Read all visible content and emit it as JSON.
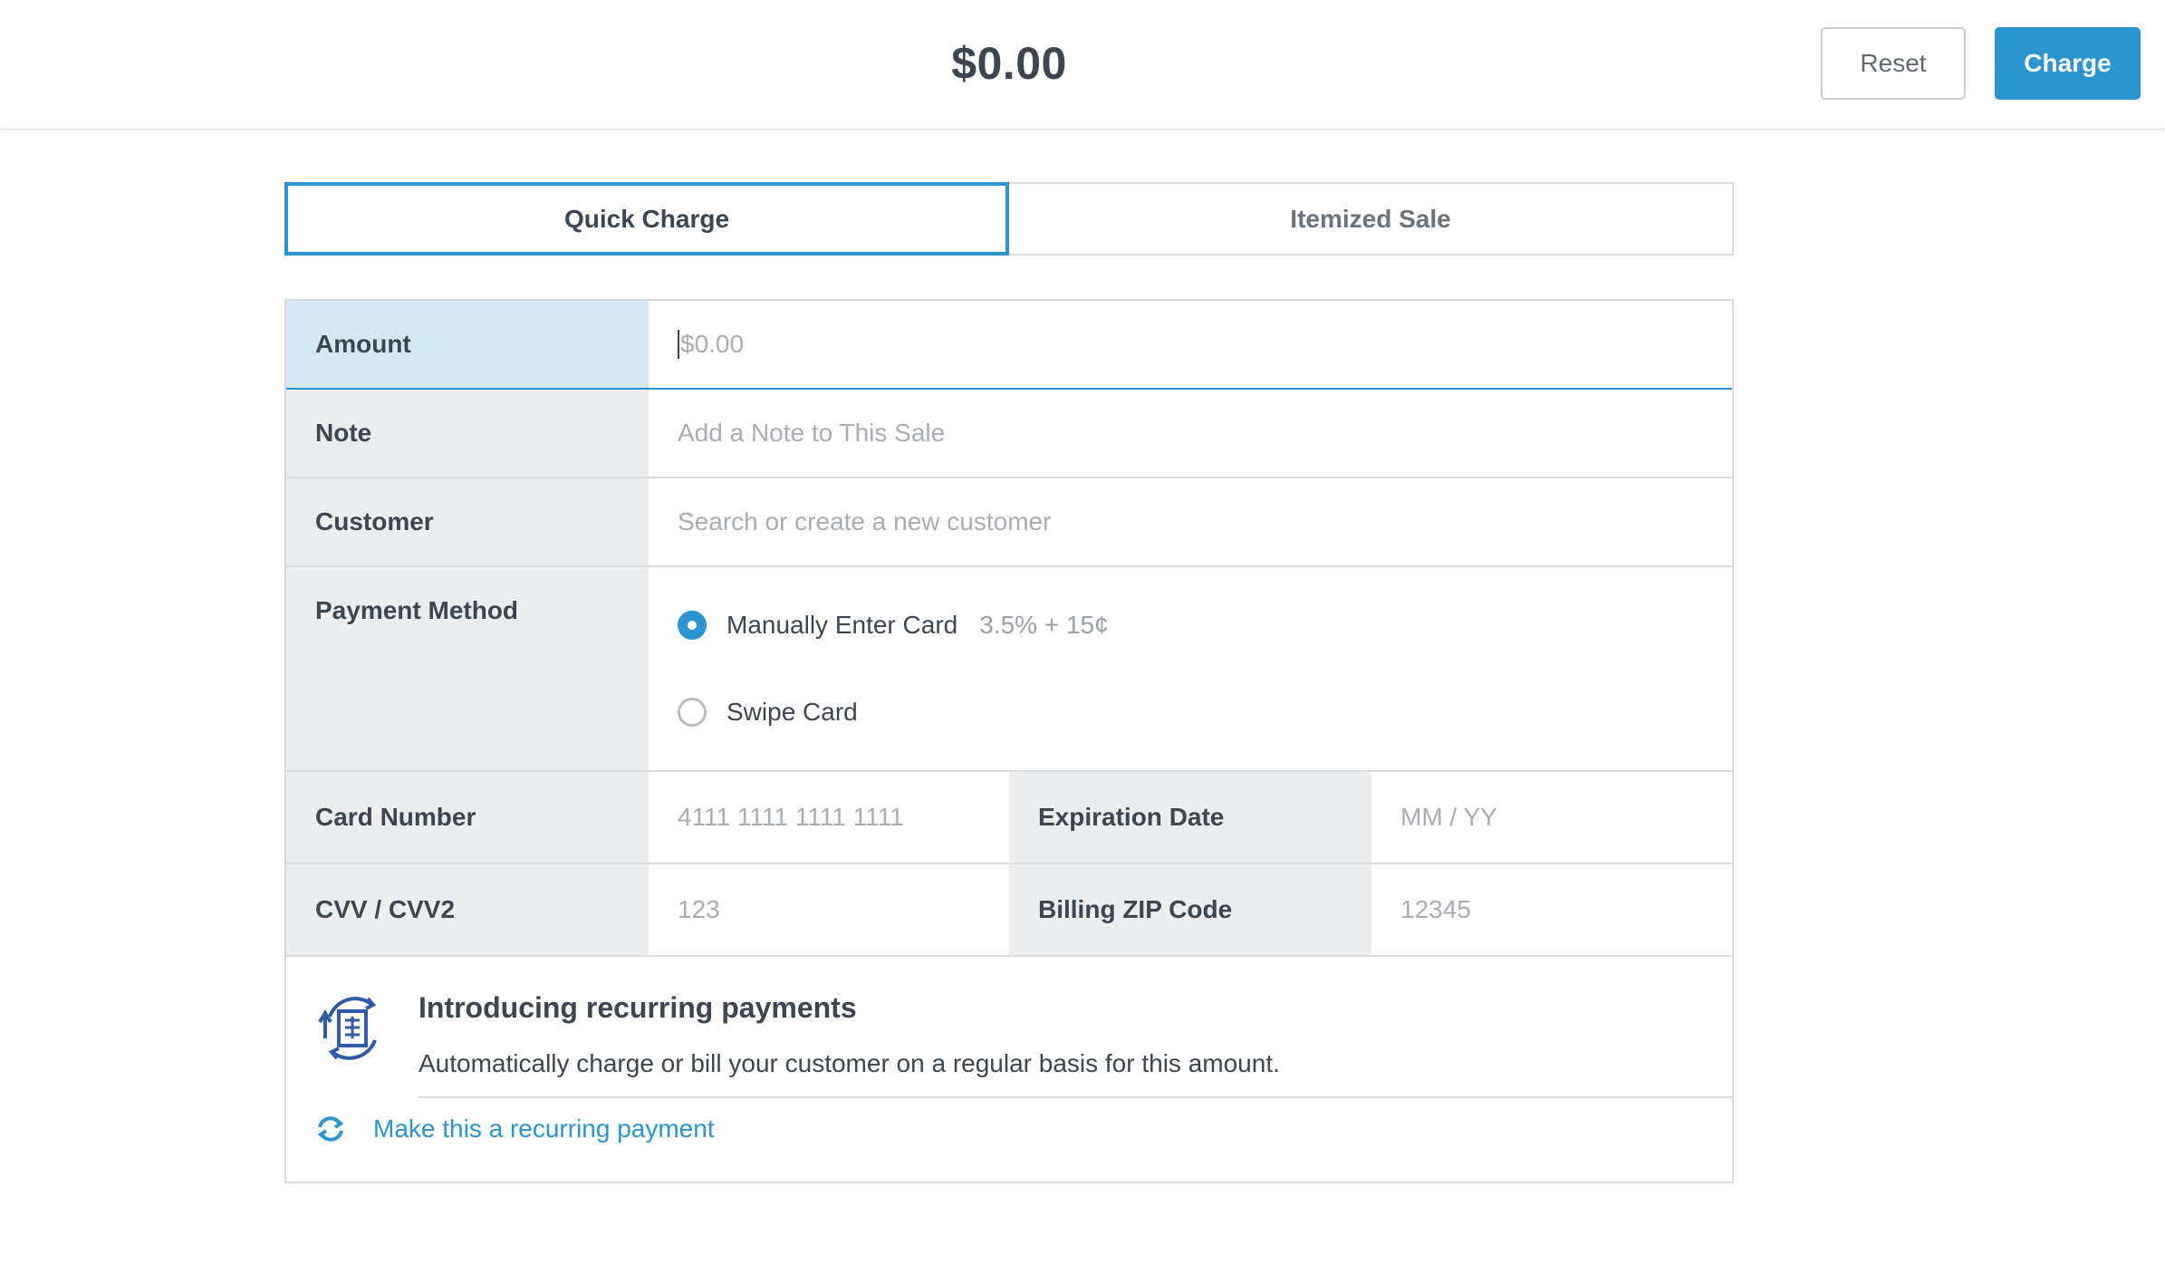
{
  "header": {
    "total": "$0.00",
    "reset_label": "Reset",
    "charge_label": "Charge"
  },
  "tabs": [
    {
      "label": "Quick Charge",
      "active": true
    },
    {
      "label": "Itemized Sale",
      "active": false
    }
  ],
  "form": {
    "amount": {
      "label": "Amount",
      "placeholder": "$0.00",
      "value": ""
    },
    "note": {
      "label": "Note",
      "placeholder": "Add a Note to This Sale"
    },
    "customer": {
      "label": "Customer",
      "placeholder": "Search or create a new customer"
    },
    "payment_method": {
      "label": "Payment Method",
      "options": [
        {
          "label": "Manually Enter Card",
          "fee": "3.5% + 15¢",
          "selected": true
        },
        {
          "label": "Swipe Card",
          "selected": false
        }
      ]
    },
    "card_number": {
      "label": "Card Number",
      "placeholder": "4111 1111 1111 1111"
    },
    "expiration": {
      "label": "Expiration Date",
      "placeholder": "MM / YY"
    },
    "cvv": {
      "label": "CVV / CVV2",
      "placeholder": "123"
    },
    "zip": {
      "label": "Billing ZIP Code",
      "placeholder": "12345"
    }
  },
  "promo": {
    "title": "Introducing recurring payments",
    "description": "Automatically charge or bill your customer on a regular basis for this amount.",
    "link_label": "Make this a recurring payment",
    "icon": "recurring-invoice-icon"
  },
  "colors": {
    "accent": "#2b94d1",
    "label_bg": "#ebedef",
    "active_label_bg": "#d5e9f5",
    "border": "#d9dcdf"
  }
}
